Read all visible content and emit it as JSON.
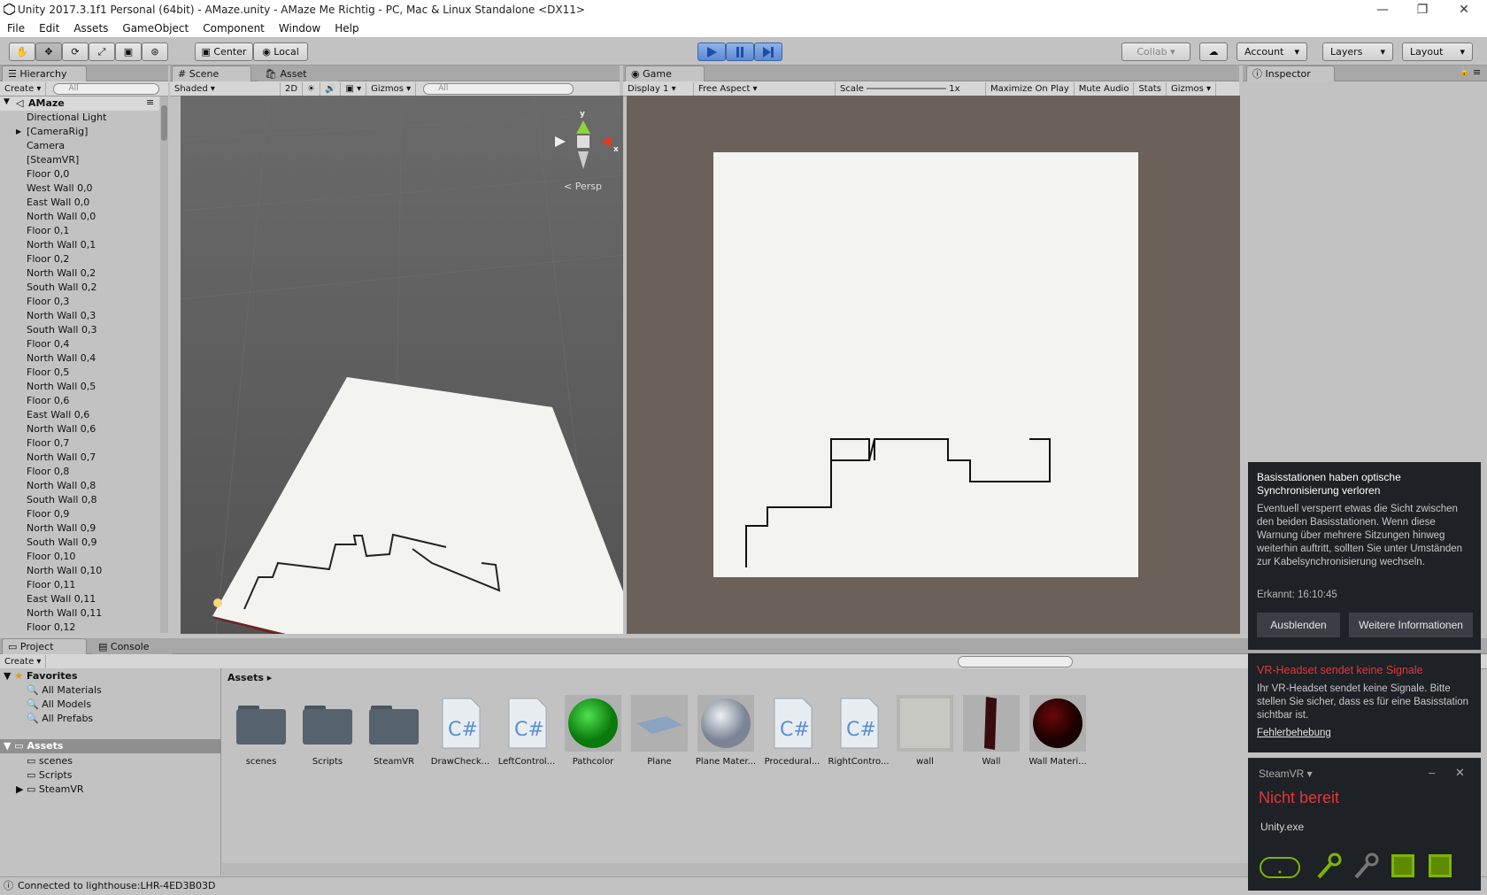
{
  "window": {
    "title": "Unity 2017.3.1f1 Personal (64bit) - AMaze.unity - AMaze Me Richtig - PC, Mac & Linux Standalone <DX11>",
    "minimize": "—",
    "restore": "❐",
    "close": "✕"
  },
  "menu": [
    "File",
    "Edit",
    "Assets",
    "GameObject",
    "Component",
    "Window",
    "Help"
  ],
  "toolbar": {
    "center": "Center",
    "local": "Local",
    "collab": "Collab ▾",
    "account": "Account",
    "layers": "Layers",
    "layout": "Layout"
  },
  "hierarchy": {
    "tab": "Hierarchy",
    "create": "Create ▾",
    "search": "All",
    "scene": "AMaze",
    "items": [
      "Directional Light",
      "[CameraRig]",
      "Camera",
      "[SteamVR]",
      "Floor 0,0",
      "West Wall 0,0",
      "East Wall 0,0",
      "North Wall 0,0",
      "Floor 0,1",
      "North Wall 0,1",
      "Floor 0,2",
      "North Wall 0,2",
      "South Wall 0,2",
      "Floor 0,3",
      "North Wall 0,3",
      "South Wall 0,3",
      "Floor 0,4",
      "North Wall 0,4",
      "Floor 0,5",
      "North Wall 0,5",
      "Floor 0,6",
      "East Wall 0,6",
      "North Wall 0,6",
      "Floor 0,7",
      "North Wall 0,7",
      "Floor 0,8",
      "North Wall 0,8",
      "South Wall 0,8",
      "Floor 0,9",
      "North Wall 0,9",
      "South Wall 0,9",
      "Floor 0,10",
      "North Wall 0,10",
      "Floor 0,11",
      "East Wall 0,11",
      "North Wall 0,11",
      "Floor 0,12"
    ]
  },
  "scene": {
    "tab": "Scene",
    "asset_store": "Asset Store",
    "shaded": "Shaded",
    "mode2d": "2D",
    "gizmos": "Gizmos",
    "search": "All",
    "persp": "Persp",
    "y": "y",
    "x": "x"
  },
  "game": {
    "tab": "Game",
    "display": "Display 1",
    "aspect": "Free Aspect",
    "scale_label": "Scale",
    "scale_value": "1x",
    "maximize": "Maximize On Play",
    "mute": "Mute Audio",
    "stats": "Stats",
    "gizmos": "Gizmos"
  },
  "inspector": {
    "tab": "Inspector"
  },
  "project": {
    "tab": "Project",
    "console": "Console",
    "create": "Create ▾",
    "favorites": "Favorites",
    "fav_items": [
      "All Materials",
      "All Models",
      "All Prefabs"
    ],
    "assets_root": "Assets",
    "folders": [
      "scenes",
      "Scripts",
      "SteamVR"
    ],
    "breadcrumb": "Assets ▸",
    "assets": [
      {
        "label": "scenes",
        "kind": "folder"
      },
      {
        "label": "Scripts",
        "kind": "folder"
      },
      {
        "label": "SteamVR",
        "kind": "folder"
      },
      {
        "label": "DrawCheck...",
        "kind": "script"
      },
      {
        "label": "LeftControl...",
        "kind": "script"
      },
      {
        "label": "Pathcolor",
        "kind": "green-sphere"
      },
      {
        "label": "Plane",
        "kind": "plane"
      },
      {
        "label": "Plane Mater...",
        "kind": "grey-sphere"
      },
      {
        "label": "Procedural...",
        "kind": "script"
      },
      {
        "label": "RightContro...",
        "kind": "script"
      },
      {
        "label": "wall",
        "kind": "texture"
      },
      {
        "label": "Wall",
        "kind": "wall"
      },
      {
        "label": "Wall Materi...",
        "kind": "red-sphere"
      }
    ]
  },
  "status": "Connected to lighthouse:LHR-4ED3B03D",
  "notif1": {
    "title": "Basisstationen haben optische Synchronisierung verloren",
    "body": "Eventuell versperrt etwas die Sicht zwischen den beiden Basisstationen. Wenn diese Warnung über mehrere Sitzungen hinweg weiterhin auftritt, sollten Sie unter Umständen zur Kabelsynchronisierung wechseln.",
    "detected": "Erkannt: 16:10:45",
    "btn_hide": "Ausblenden",
    "btn_more": "Weitere Informationen"
  },
  "notif2": {
    "title": "VR-Headset sendet keine Signale",
    "body": "Ihr VR-Headset sendet keine Signale. Bitte stellen Sie sicher, dass es für eine Basisstation sichtbar ist.",
    "link": "Fehlerbehebung"
  },
  "steamvr": {
    "title": "SteamVR ▾",
    "status": "Nicht bereit",
    "app": "Unity.exe",
    "minimize": "–",
    "close": "✕"
  },
  "colors": {
    "accent_red": "#e0383a",
    "steam_bg": "#1e2125",
    "green": "#7db600"
  }
}
